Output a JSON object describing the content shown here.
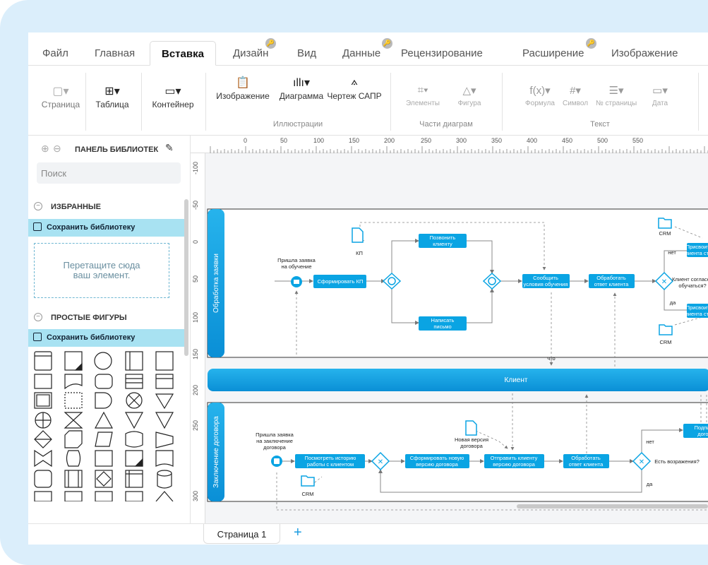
{
  "menu": {
    "tabs": [
      "Файл",
      "Главная",
      "Вставка",
      "Дизайн",
      "Вид",
      "Данные",
      "Рецензирование",
      "Расширение",
      "Изображение"
    ],
    "active_tab": "Вставка"
  },
  "toolbar": {
    "page": "Страница",
    "table": "Таблица",
    "container": "Контейнер",
    "image": "Изображение",
    "diagram": "Диаграмма",
    "cad": "Чертеж САПР",
    "group_illustrations": "Иллюстрации",
    "elements": "Элементы",
    "figure": "Фигура",
    "group_parts": "Части диаграм",
    "formula": "Формула",
    "symbol": "Символ",
    "page_number": "№ страницы",
    "date": "Дата",
    "group_text": "Текст"
  },
  "sidebar": {
    "title": "ПАНЕЛЬ БИБЛИОТЕК",
    "search_placeholder": "Поиск",
    "favorites": "ИЗБРАННЫЕ",
    "save_library": "Сохранить библиотеку",
    "drop_line1": "Перетащите сюда",
    "drop_line2": "ваш элемент.",
    "simple_shapes": "ПРОСТЫЕ ФИГУРЫ"
  },
  "ruler": {
    "top": [
      "0",
      "50",
      "100",
      "150",
      "200",
      "250",
      "300",
      "350",
      "400",
      "450",
      "500",
      "550"
    ],
    "left": [
      "-100",
      "-50",
      "0",
      "50",
      "100",
      "150",
      "200",
      "250",
      "300"
    ]
  },
  "diagram": {
    "lane1": "Обработка заявки",
    "lane2": "Заключение договора",
    "pool": "Клиент",
    "start1_label1": "Пришла заявка",
    "start1_label2": "на обучение",
    "task_form_kp": "Сформировать КП",
    "doc_kp": "КП",
    "task_call1": "Позвонить",
    "task_call2": "клиенту",
    "task_write1": "Написать",
    "task_write2": "письмо",
    "task_report1": "Сообщить",
    "task_report2": "условия обучения",
    "task_process1": "Обработать",
    "task_process2": "ответ клиента",
    "gw_question1": "Клиент согласен",
    "gw_question2": "обучаться?",
    "no": "нет",
    "yes": "да",
    "task_assign1": "Присвоить з",
    "task_assign2": "клиента статус",
    "task_assign3": "Присвоить з",
    "task_assign4": "клиента статус",
    "crm": "CRM",
    "start2_label1": "Пришла заявка",
    "start2_label2": "на заключение",
    "start2_label3": "договора",
    "task_history1": "Посмотреть историю",
    "task_history2": "работы с клиентом",
    "task_newver1": "Сформировать новую",
    "task_newver2": "версию договора",
    "task_send1": "Отправить клиенту",
    "task_send2": "версию договора",
    "task_proc2_1": "Обработать",
    "task_proc2_2": "ответ клиента",
    "doc_new1": "Новая версия",
    "doc_new2": "договора",
    "task_sign1": "Подписать",
    "task_sign2": "договор",
    "objections": "Есть возражения?",
    "small_label": "что"
  },
  "pagebar": {
    "page1": "Страница 1",
    "add": "+"
  },
  "colors": {
    "accent": "#0aa4e3",
    "save_bar": "#a8e2f2",
    "frame": "#dbeefb"
  }
}
